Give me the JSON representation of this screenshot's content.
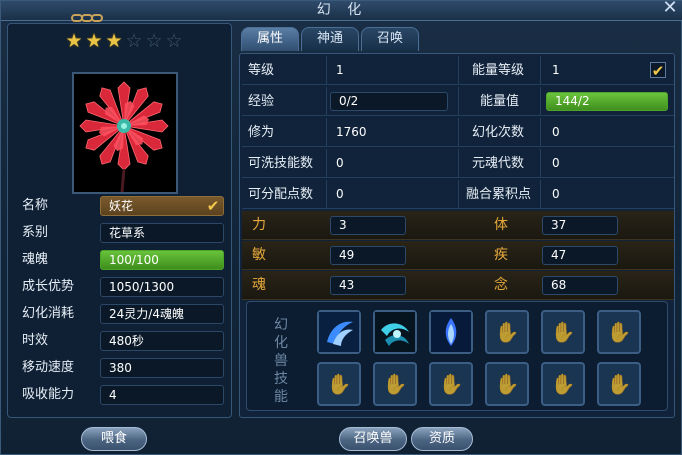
{
  "window": {
    "title": "幻 化"
  },
  "pet": {
    "stars_filled": 3,
    "stars_total": 6,
    "attributes": [
      {
        "label": "名称",
        "value": "妖花"
      },
      {
        "label": "系别",
        "value": "花草系"
      },
      {
        "label": "魂魄",
        "value": "100/100"
      },
      {
        "label": "成长优势",
        "value": "1050/1300"
      },
      {
        "label": "幻化消耗",
        "value": "24灵力/4魂魄"
      },
      {
        "label": "时效",
        "value": "480秒"
      },
      {
        "label": "移动速度",
        "value": "380"
      },
      {
        "label": "吸收能力",
        "value": "4"
      }
    ]
  },
  "tabs": [
    {
      "label": "属性"
    },
    {
      "label": "神通"
    },
    {
      "label": "召唤"
    }
  ],
  "stats": {
    "level_label": "等级",
    "level_value": "1",
    "energy_level_label": "能量等级",
    "energy_level_value": "1",
    "exp_label": "经验",
    "exp_value": "0/2",
    "energy_label": "能量值",
    "energy_value": "144/2",
    "cultivation_label": "修为",
    "cultivation_value": "1760",
    "transform_count_label": "幻化次数",
    "transform_count_value": "0",
    "washable_label": "可洗技能数",
    "washable_value": "0",
    "soul_gen_label": "元魂代数",
    "soul_gen_value": "0",
    "points_label": "可分配点数",
    "points_value": "0",
    "fusion_label": "融合累积点",
    "fusion_value": "0"
  },
  "base_stats": [
    {
      "left_label": "力",
      "left_value": "3",
      "right_label": "体",
      "right_value": "37"
    },
    {
      "left_label": "敏",
      "left_value": "49",
      "right_label": "疾",
      "right_value": "47"
    },
    {
      "left_label": "魂",
      "left_value": "43",
      "right_label": "念",
      "right_value": "68"
    }
  ],
  "skills": {
    "title_chars": [
      "幻",
      "化",
      "兽",
      "技",
      "能"
    ],
    "slots": [
      {
        "icon": "blue-wave-skill-icon"
      },
      {
        "icon": "cyan-whirl-skill-icon"
      },
      {
        "icon": "blue-spirit-skill-icon"
      },
      {
        "icon": "empty-slot-icon"
      },
      {
        "icon": "empty-slot-icon"
      },
      {
        "icon": "empty-slot-icon"
      },
      {
        "icon": "empty-slot-icon"
      },
      {
        "icon": "empty-slot-icon"
      },
      {
        "icon": "empty-slot-icon"
      },
      {
        "icon": "empty-slot-icon"
      },
      {
        "icon": "empty-slot-icon"
      },
      {
        "icon": "empty-slot-icon"
      }
    ]
  },
  "buttons": {
    "feed": "喂食",
    "summon": "召唤兽",
    "aptitude": "资质"
  },
  "colors": {
    "accent_gold": "#e5a93c",
    "green_bar": "#68c23a",
    "star_gold": "#e8c346"
  }
}
